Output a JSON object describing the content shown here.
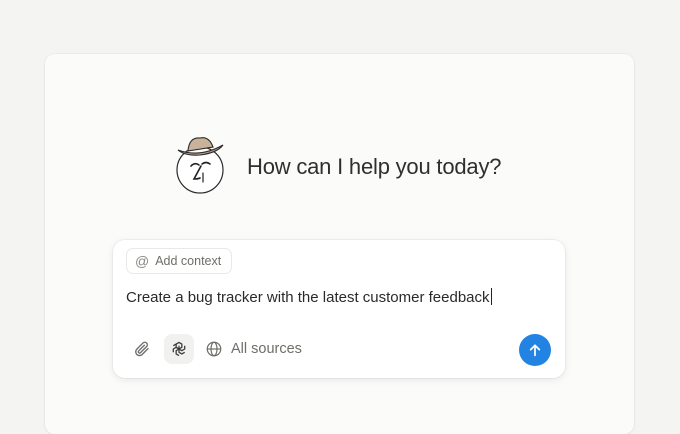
{
  "greeting": {
    "avatar_icon": "notion-face-with-hat-icon",
    "text": "How can I help you today?"
  },
  "composer": {
    "context_chip": {
      "icon": "at-sign-icon",
      "label": "Add context"
    },
    "input_value": "Create a bug tracker with the latest customer feedback",
    "toolbar": {
      "attach_icon": "paperclip-icon",
      "model_icon": "openai-logo-icon",
      "sources_icon": "globe-icon",
      "sources_label": "All sources",
      "send_icon": "arrow-up-icon"
    }
  },
  "colors": {
    "accent": "#2383e2",
    "background": "#f4f4f3",
    "card": "#fbfbfa",
    "text": "#2f2f2f",
    "muted": "#6f6e69"
  }
}
